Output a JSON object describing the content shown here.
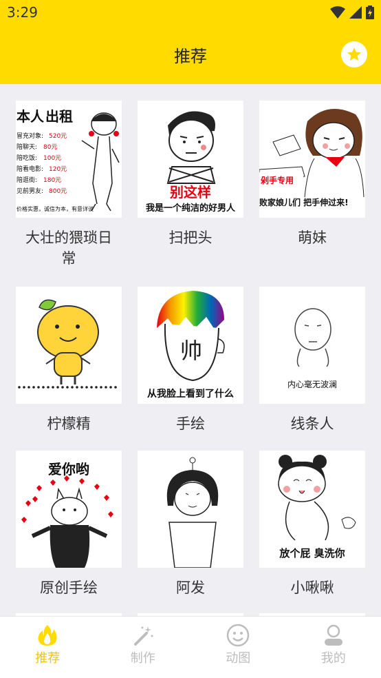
{
  "status": {
    "time": "3:29"
  },
  "appbar": {
    "title": "推荐",
    "star_icon": "star-icon"
  },
  "grid": [
    {
      "label": "大壮的猥琐日常",
      "text": {
        "title_a": "本人",
        "title_b": "出租",
        "rows": [
          [
            "冒充对象:",
            "520元"
          ],
          [
            "陪聊天:",
            "80元"
          ],
          [
            "陪吃饭:",
            "100元"
          ],
          [
            "陪看电影:",
            "120元"
          ],
          [
            "陪逛街:",
            "180元"
          ],
          [
            "见前男友:",
            "800元"
          ]
        ],
        "footer": "价格实惠，诚信为本，有意详谈"
      }
    },
    {
      "label": "扫把头",
      "text": {
        "red": "别这样",
        "black": "我是一个纯洁的好男人"
      }
    },
    {
      "label": "萌妹",
      "text": {
        "sign": "剁手专用",
        "bottom": "败家娘儿们 把手伸过来!"
      }
    },
    {
      "label": "柠檬精"
    },
    {
      "label": "手绘",
      "text": {
        "face": "帅",
        "bottom": "从我脸上看到了什么"
      }
    },
    {
      "label": "线条人",
      "text": {
        "bottom": "内心毫无波澜"
      }
    },
    {
      "label": "原创手绘",
      "text": {
        "top": "爱你哟"
      }
    },
    {
      "label": "阿发"
    },
    {
      "label": "小啾啾",
      "text": {
        "bottom": "放个屁 臭洗你"
      }
    }
  ],
  "tabs": [
    {
      "label": "推荐",
      "icon": "flame-icon",
      "active": true
    },
    {
      "label": "制作",
      "icon": "magic-wand-icon"
    },
    {
      "label": "动图",
      "icon": "smiley-icon"
    },
    {
      "label": "我的",
      "icon": "person-icon"
    }
  ],
  "colors": {
    "accent": "#FFDB00",
    "tab_active": "#F5C400",
    "tab_inactive": "#BDBDBD",
    "background": "#EEEEF3",
    "meme_red": "#E60012"
  }
}
